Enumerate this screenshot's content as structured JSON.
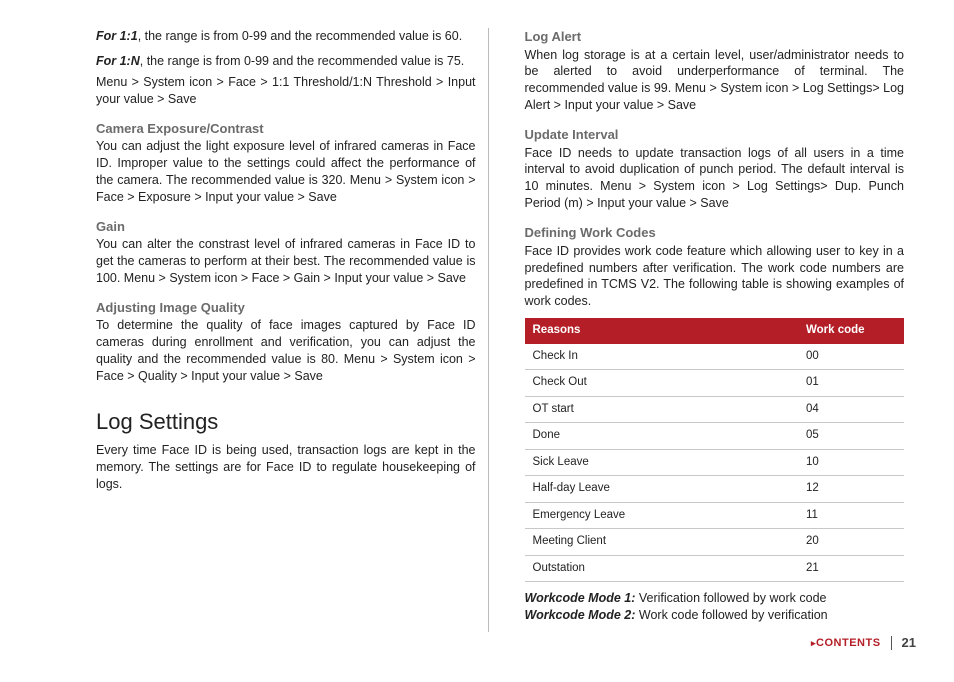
{
  "left": {
    "for11_label": "For 1:1",
    "for11_text": ", the range is from 0-99 and the  recommended value is 60.",
    "for1n_label": "For 1:N",
    "for1n_text": ", the range is from 0-99 and the recommended value is 75.",
    "path_threshold": "Menu > System icon > Face > 1:1 Threshold/1:N Threshold > Input your value > Save",
    "h_exposure": "Camera Exposure/Contrast",
    "p_exposure": "You can adjust the light exposure level of infrared cameras in Face ID. Improper value to the settings could affect the performance of the camera. The recommended value is 320. Menu > System icon > Face > Exposure > Input your value > Save",
    "h_gain": "Gain",
    "p_gain": "You can alter the constrast level of infrared cameras in Face ID to get the cameras to perform at their best. The recommended value is 100. Menu > System icon > Face > Gain > Input your value > Save",
    "h_quality": "Adjusting Image Quality",
    "p_quality": "To determine the quality of face images captured by Face ID cameras during enrollment and verification, you can adjust the quality and the recommended value is 80. Menu > System icon > Face > Quality > Input your value > Save",
    "h_log": "Log Settings",
    "p_log": "Every time Face ID is being used, transaction logs are kept in the memory. The settings are for Face ID to regulate housekeeping of logs."
  },
  "right": {
    "h_alert": "Log Alert",
    "p_alert": "When log storage is at a certain level, user/administrator needs to be alerted to avoid underperformance of terminal. The recommended value is 99. Menu > System icon > Log Settings> Log Alert > Input your value > Save",
    "h_update": "Update Interval",
    "p_update": "Face ID needs to update transaction logs of all users in a time interval to avoid duplication of punch period. The default interval is 10 minutes. Menu > System icon > Log Settings> Dup. Punch Period (m) > Input your value > Save",
    "h_codes": "Defining Work Codes",
    "p_codes": "Face ID provides work code feature which allowing user to key in a predefined numbers after verification. The work code numbers are predefined in TCMS V2. The following table is showing examples of work codes.",
    "table": {
      "col_reason": "Reasons",
      "col_code": "Work code",
      "rows": [
        {
          "reason": "Check In",
          "code": "00"
        },
        {
          "reason": "Check Out",
          "code": "01"
        },
        {
          "reason": "OT start",
          "code": "04"
        },
        {
          "reason": "Done",
          "code": "05"
        },
        {
          "reason": "Sick Leave",
          "code": "10"
        },
        {
          "reason": "Half-day Leave",
          "code": "12"
        },
        {
          "reason": "Emergency Leave",
          "code": "11"
        },
        {
          "reason": "Meeting Client",
          "code": "20"
        },
        {
          "reason": "Outstation",
          "code": "21"
        }
      ]
    },
    "mode1_label": "Workcode Mode 1:",
    "mode1_text": " Verification followed by work code",
    "mode2_label": "Workcode Mode 2:",
    "mode2_text": " Work code followed by verification"
  },
  "footer": {
    "contents": "CONTENTS",
    "page": "21"
  }
}
